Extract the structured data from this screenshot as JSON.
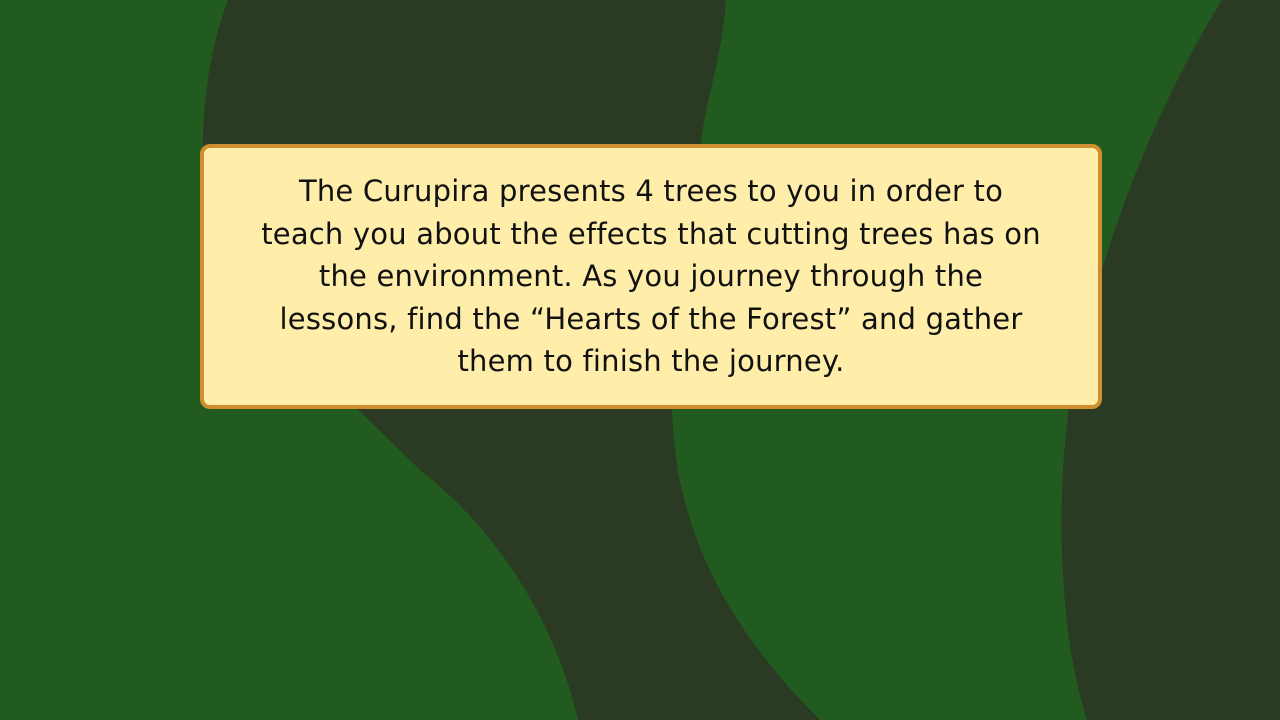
{
  "scene": {
    "colors": {
      "background": "#215b1f",
      "dark_band": "#2b3a22",
      "dialog_fill": "#feeeaa",
      "dialog_border": "#cf8e30",
      "text": "#111111"
    }
  },
  "dialog": {
    "lines": [
      "The Curupira presents 4 trees to you in order to",
      "teach you about the effects that cutting trees has on",
      "the environment. As you journey through the",
      "lessons, find the “Hearts of the Forest” and gather",
      "them to finish the journey."
    ]
  }
}
